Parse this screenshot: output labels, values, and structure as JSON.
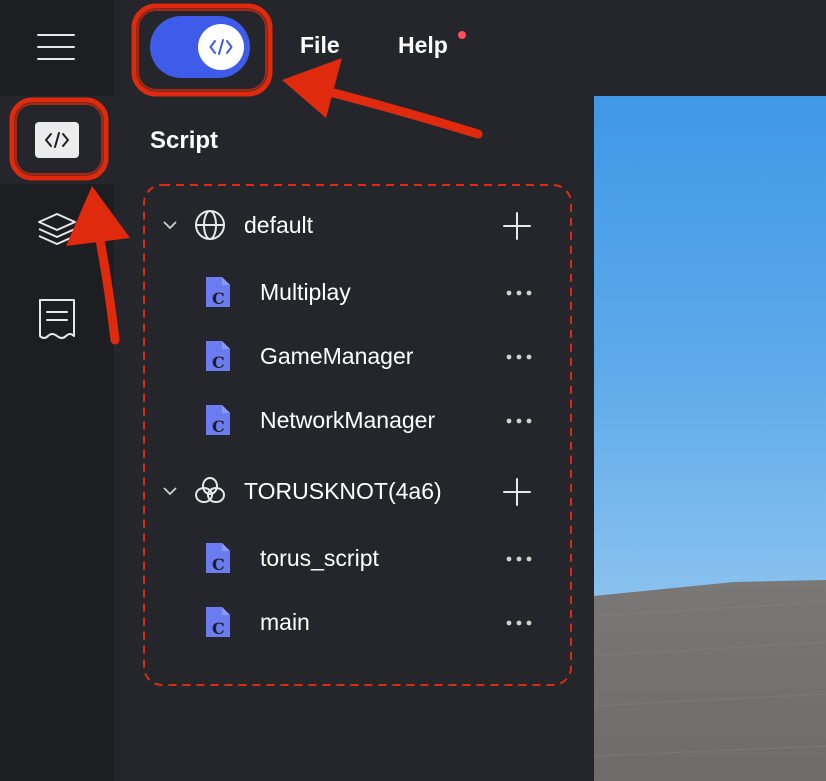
{
  "topbar": {
    "menus": [
      "File",
      "Help"
    ],
    "help_has_notification": true
  },
  "sidebar": {
    "items": [
      {
        "icon": "hamburger-menu-icon"
      },
      {
        "icon": "code-icon",
        "active": true
      },
      {
        "icon": "layers-icon"
      },
      {
        "icon": "receipt-icon"
      }
    ]
  },
  "panel": {
    "title": "Script",
    "groups": [
      {
        "label": "default",
        "icon": "globe-icon",
        "expanded": true,
        "items": [
          "Multiplay",
          "GameManager",
          "NetworkManager"
        ]
      },
      {
        "label": "TORUSKNOT(4a6)",
        "icon": "torus-knot-icon",
        "expanded": true,
        "items": [
          "torus_script",
          "main"
        ]
      }
    ]
  },
  "colors": {
    "accent": "#3f5bea",
    "file_icon": "#6a7cf0",
    "background": "#25262b",
    "rail": "#1d1e22",
    "annotation": "#e02a0e",
    "notification_dot": "#ff4d5e"
  }
}
